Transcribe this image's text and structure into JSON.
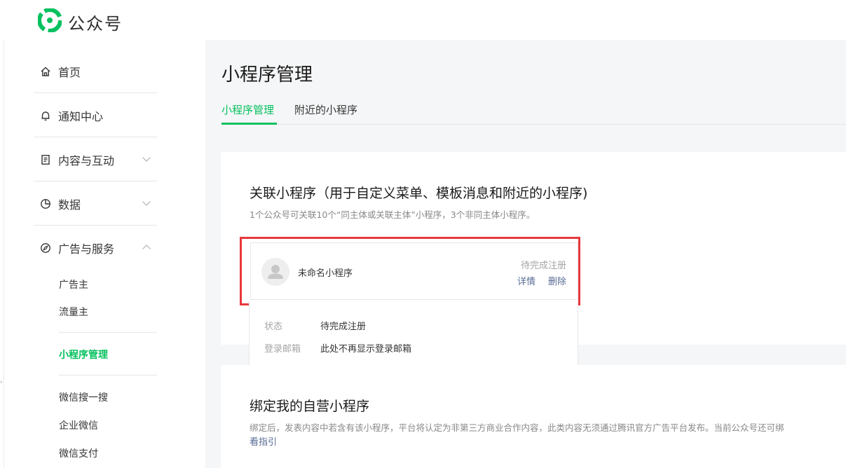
{
  "app": {
    "name": "公众号",
    "brand_color": "#07c160"
  },
  "sidebar": {
    "items": [
      {
        "label": "首页",
        "icon": "home-icon"
      },
      {
        "label": "通知中心",
        "icon": "bell-icon"
      },
      {
        "label": "内容与互动",
        "icon": "document-icon",
        "expandable": true
      },
      {
        "label": "数据",
        "icon": "pie-chart-icon",
        "expandable": true
      },
      {
        "label": "广告与服务",
        "icon": "compass-icon",
        "expanded": true
      }
    ],
    "sub_items_group1": [
      "广告主",
      "流量主"
    ],
    "active_item": "小程序管理",
    "sub_items_group2": [
      "微信搜一搜",
      "企业微信",
      "微信支付"
    ]
  },
  "main": {
    "title": "小程序管理",
    "tabs": [
      {
        "label": "小程序管理",
        "active": true
      },
      {
        "label": "附近的小程序",
        "active": false
      }
    ],
    "linked_section": {
      "title": "关联小程序（用于自定义菜单、模板消息和附近的小程序)",
      "desc": "1个公众号可关联10个“同主体或关联主体”小程序，3个非同主体小程序。",
      "item": {
        "name": "未命名小程序",
        "status": "待完成注册",
        "detail_link": "详情",
        "delete_link": "删除"
      },
      "details": [
        {
          "label": "状态",
          "value": "待完成注册"
        },
        {
          "label": "登录邮箱",
          "value": "此处不再显示登录邮箱"
        }
      ]
    },
    "own_section": {
      "title": "绑定我的自营小程序",
      "desc": "绑定后，发表内容中若含有该小程序，平台将认定为非第三方商业合作内容，此类内容无须通过腾讯官方广告平台发布。当前公众号还可绑",
      "guide_link": "看指引"
    }
  }
}
